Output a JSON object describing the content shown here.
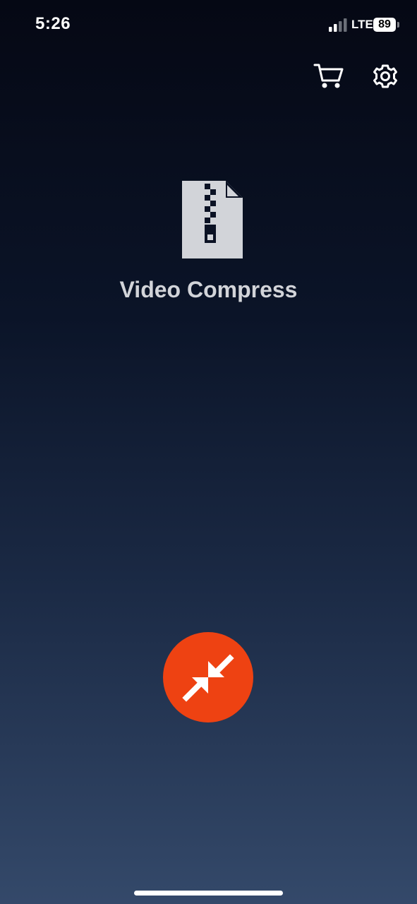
{
  "status_bar": {
    "time": "5:26",
    "network": "LTE",
    "battery_level": "89"
  },
  "header": {
    "cart_icon": "shopping-cart-icon",
    "settings_icon": "gear-icon"
  },
  "main": {
    "app_icon": "zip-file-icon",
    "title": "Video Compress"
  },
  "action": {
    "compress_icon": "compress-arrows-icon",
    "color": "#ee4212"
  },
  "colors": {
    "accent": "#ee4212",
    "title_text": "#d2d4d9",
    "background_top": "#050814",
    "background_bottom": "#34496a"
  }
}
